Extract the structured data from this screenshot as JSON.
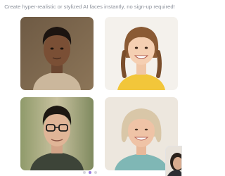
{
  "subtitle": "Create hyper-realistic or stylized AI faces instantly, no sign-up required!",
  "gallery": {
    "cards": [
      {
        "icon": "portrait-young-man-curly-hair"
      },
      {
        "icon": "portrait-smiling-girl-braids"
      },
      {
        "icon": "portrait-man-glasses"
      },
      {
        "icon": "portrait-older-woman-smiling"
      }
    ],
    "preview_thumbnail": {
      "icon": "portrait-partial-thumbnail"
    }
  },
  "carousel": {
    "dots": 3,
    "active_index": 1
  },
  "colors": {
    "accent": "#9b7de0",
    "subtitle_text": "#8a8f99"
  }
}
